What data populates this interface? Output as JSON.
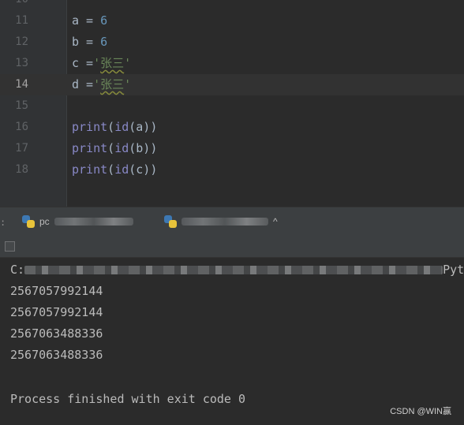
{
  "editor": {
    "lines": [
      {
        "num": "10"
      },
      {
        "num": "11",
        "var": "a",
        "op": " = ",
        "val": "6"
      },
      {
        "num": "12",
        "var": "b",
        "op": " = ",
        "val": "6"
      },
      {
        "num": "13",
        "var": "c",
        "op": " =",
        "q1": "'",
        "str": "张三",
        "q2": "'"
      },
      {
        "num": "14",
        "var": "d",
        "op": " =",
        "q1": "'",
        "str": "张三",
        "q2": "'"
      },
      {
        "num": "15"
      },
      {
        "num": "16",
        "fn": "print",
        "open": "(",
        "inner": "id",
        "args": "(a))"
      },
      {
        "num": "17",
        "fn": "print",
        "open": "(",
        "inner": "id",
        "args": "(b))"
      },
      {
        "num": "18",
        "fn": "print",
        "open": "(",
        "inner": "id",
        "args": "(c))"
      }
    ],
    "current_line": "14"
  },
  "run_panel": {
    "tab1_label": "pc",
    "tab2_label": "^"
  },
  "console": {
    "command_prefix": "C:",
    "command_suffix": "Pyth",
    "outputs": [
      "2567057992144",
      "2567057992144",
      "2567063488336",
      "2567063488336"
    ],
    "exit_message": "Process finished with exit code 0"
  },
  "watermark": "CSDN @WIN赢"
}
